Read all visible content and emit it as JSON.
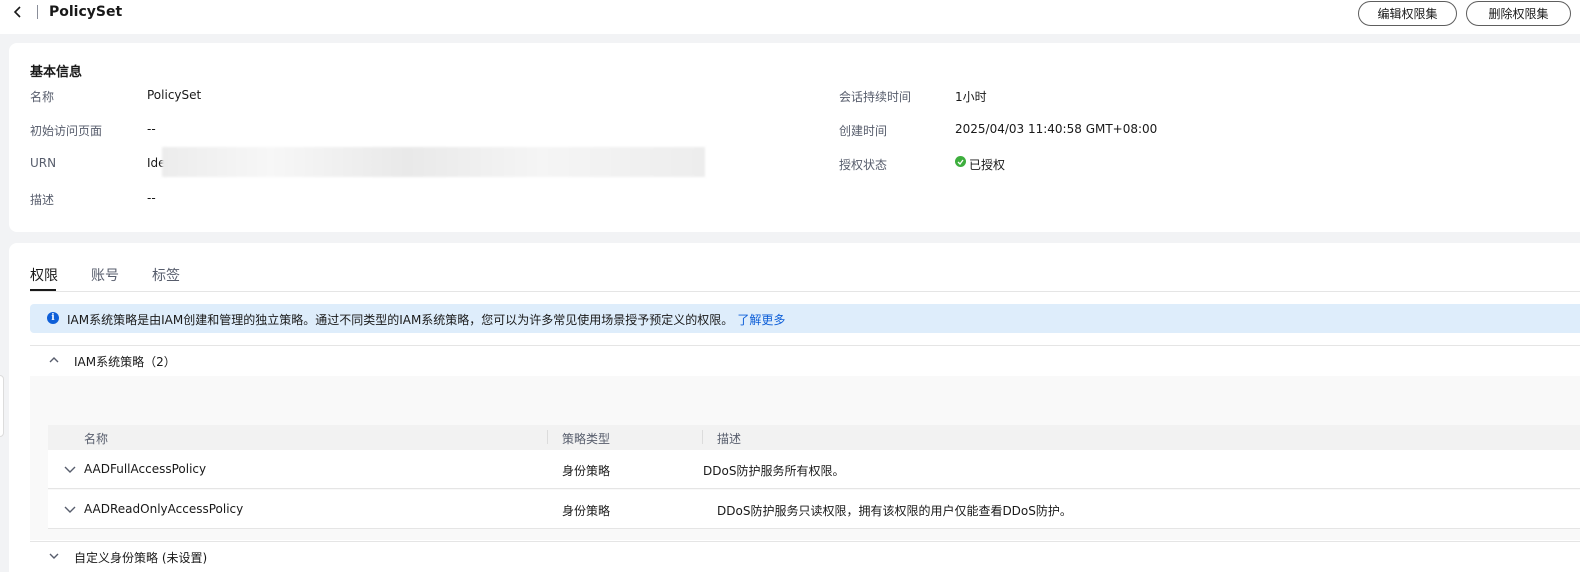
{
  "header": {
    "title": "PolicySet",
    "edit_button": "编辑权限集",
    "delete_button": "删除权限集"
  },
  "basic_info": {
    "section_title": "基本信息",
    "name_label": "名称",
    "name_value": "PolicySet",
    "start_page_label": "初始访问页面",
    "start_page_value": "--",
    "urn_label": "URN",
    "urn_value": "Ide",
    "desc_label": "描述",
    "desc_value": "--",
    "session_label": "会话持续时间",
    "session_value": "1小时",
    "created_label": "创建时间",
    "created_value": "2025/04/03 11:40:58 GMT+08:00",
    "auth_label": "授权状态",
    "auth_value": "已授权",
    "status_color": "#3dae3d"
  },
  "tabs": [
    {
      "label": "权限",
      "active": true
    },
    {
      "label": "账号",
      "active": false
    },
    {
      "label": "标签",
      "active": false
    }
  ],
  "alert": {
    "text": "IAM系统策略是由IAM创建和管理的独立策略。通过不同类型的IAM系统策略，您可以为许多常见使用场景授予预定义的权限。",
    "link": "了解更多"
  },
  "iam_section": {
    "title": "IAM系统策略（2）",
    "columns": [
      "名称",
      "策略类型",
      "描述"
    ],
    "rows": [
      {
        "name": "AADFullAccessPolicy",
        "type": "身份策略",
        "desc": "DDoS防护服务所有权限。"
      },
      {
        "name": "AADReadOnlyAccessPolicy",
        "type": "身份策略",
        "desc": "DDoS防护服务只读权限，拥有该权限的用户仅能查看DDoS防护。"
      }
    ]
  },
  "custom_section": {
    "title": "自定义身份策略 (未设置)"
  },
  "colors": {
    "accent": "#0e5fd8",
    "alert_bg": "#deedfb"
  }
}
